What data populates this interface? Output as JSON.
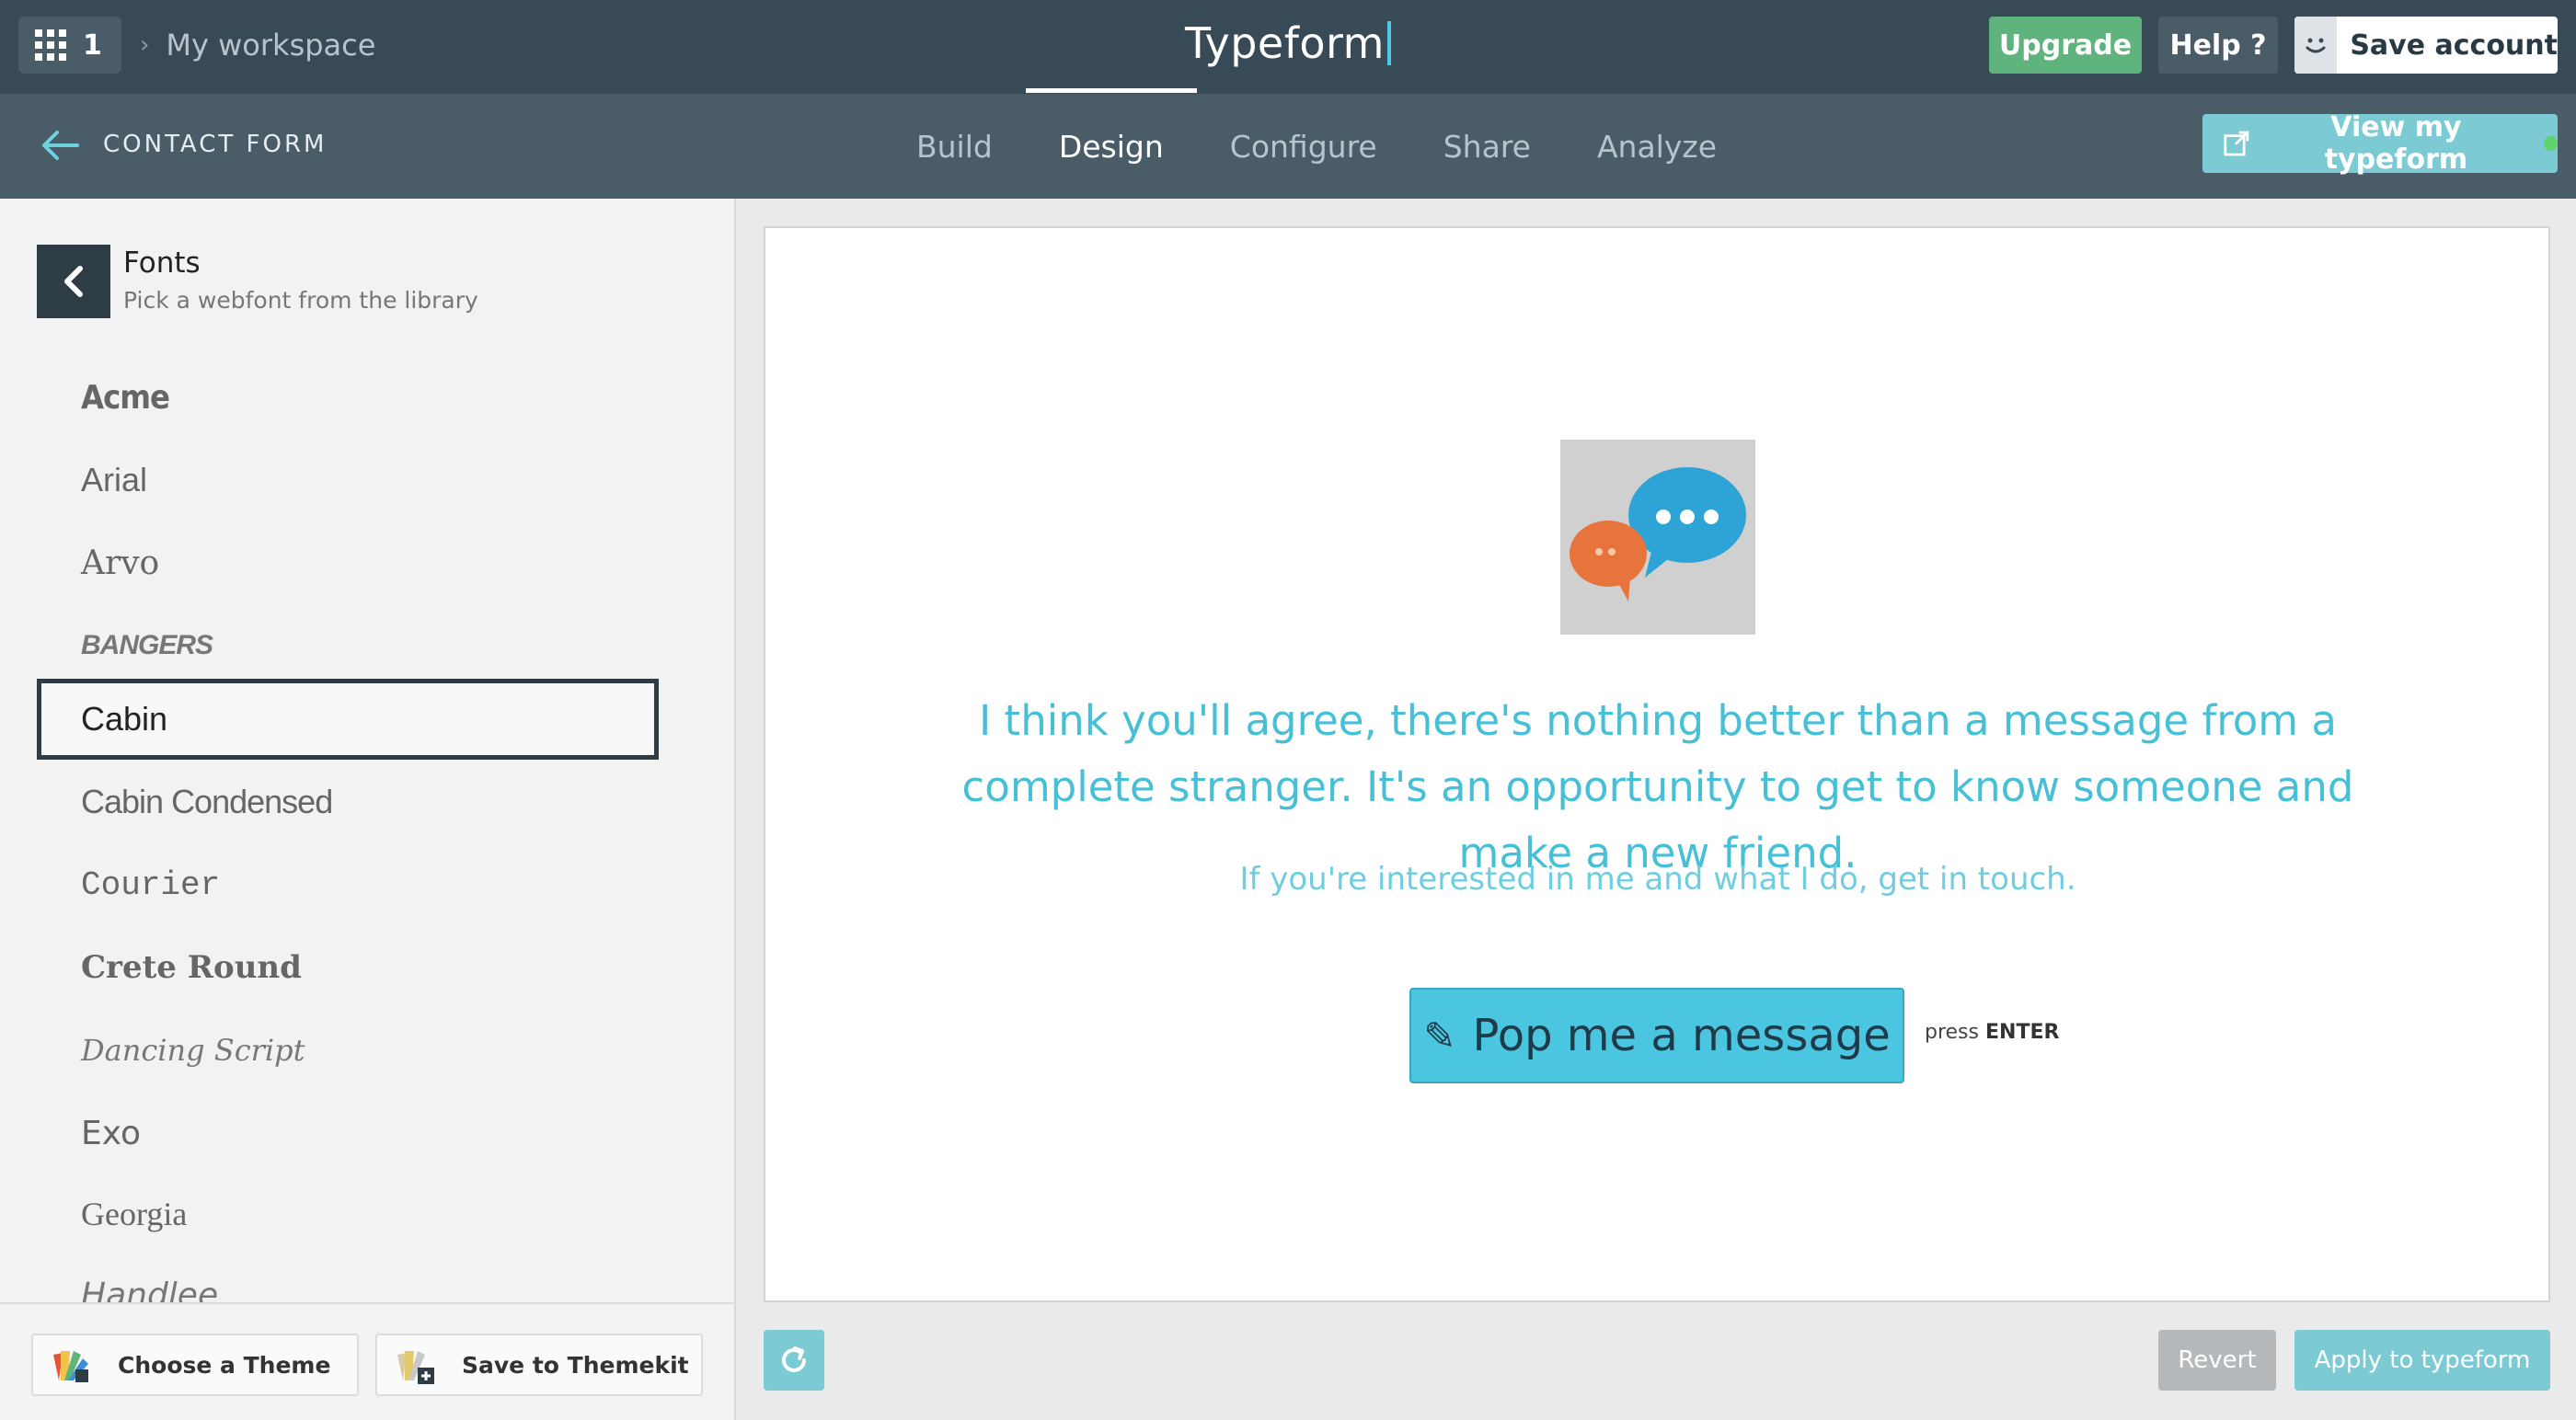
{
  "topbar": {
    "workspace_count": "1",
    "breadcrumb": "My workspace",
    "brand": "Typeform",
    "upgrade_label": "Upgrade",
    "help_label": "Help ?",
    "save_account_label": "Save account"
  },
  "subbar": {
    "form_name": "CONTACT FORM",
    "tabs": [
      {
        "label": "Build"
      },
      {
        "label": "Design"
      },
      {
        "label": "Configure"
      },
      {
        "label": "Share"
      },
      {
        "label": "Analyze"
      }
    ],
    "active_tab": "Design",
    "view_label": "View my typeform"
  },
  "panel": {
    "title": "Fonts",
    "subtitle": "Pick a webfont from the library",
    "fonts": [
      {
        "name": "Acme"
      },
      {
        "name": "Arial"
      },
      {
        "name": "Arvo"
      },
      {
        "name": "BANGERS"
      },
      {
        "name": "Cabin"
      },
      {
        "name": "Cabin Condensed"
      },
      {
        "name": "Courier"
      },
      {
        "name": "Crete Round"
      },
      {
        "name": "Dancing Script"
      },
      {
        "name": "Exo"
      },
      {
        "name": "Georgia"
      },
      {
        "name": "Handlee"
      }
    ],
    "selected_font": "Cabin",
    "choose_theme_label": "Choose a Theme",
    "save_themekit_label": "Save to Themekit"
  },
  "preview": {
    "message": "I think you'll agree, there's nothing better than a message from a complete stranger. It's an opportunity to get to know someone and make a new friend.",
    "sub_message": "If you're interested in me and what I do, get in touch.",
    "cta_label": "Pop me a message",
    "hint_press": "press",
    "hint_key": "ENTER"
  },
  "footer": {
    "revert_label": "Revert",
    "apply_label": "Apply to typeform"
  },
  "colors": {
    "topbar": "#384a56",
    "subbar": "#4a5c68",
    "upgrade": "#5fb37c",
    "accent": "#7ccad4",
    "text_accent": "#47bfd6",
    "cta": "#4bc6e0"
  },
  "icons": {
    "apps": "grid-icon",
    "back": "arrow-left-icon",
    "external": "external-link-icon",
    "refresh": "refresh-icon",
    "avatar": "smiley-icon"
  }
}
